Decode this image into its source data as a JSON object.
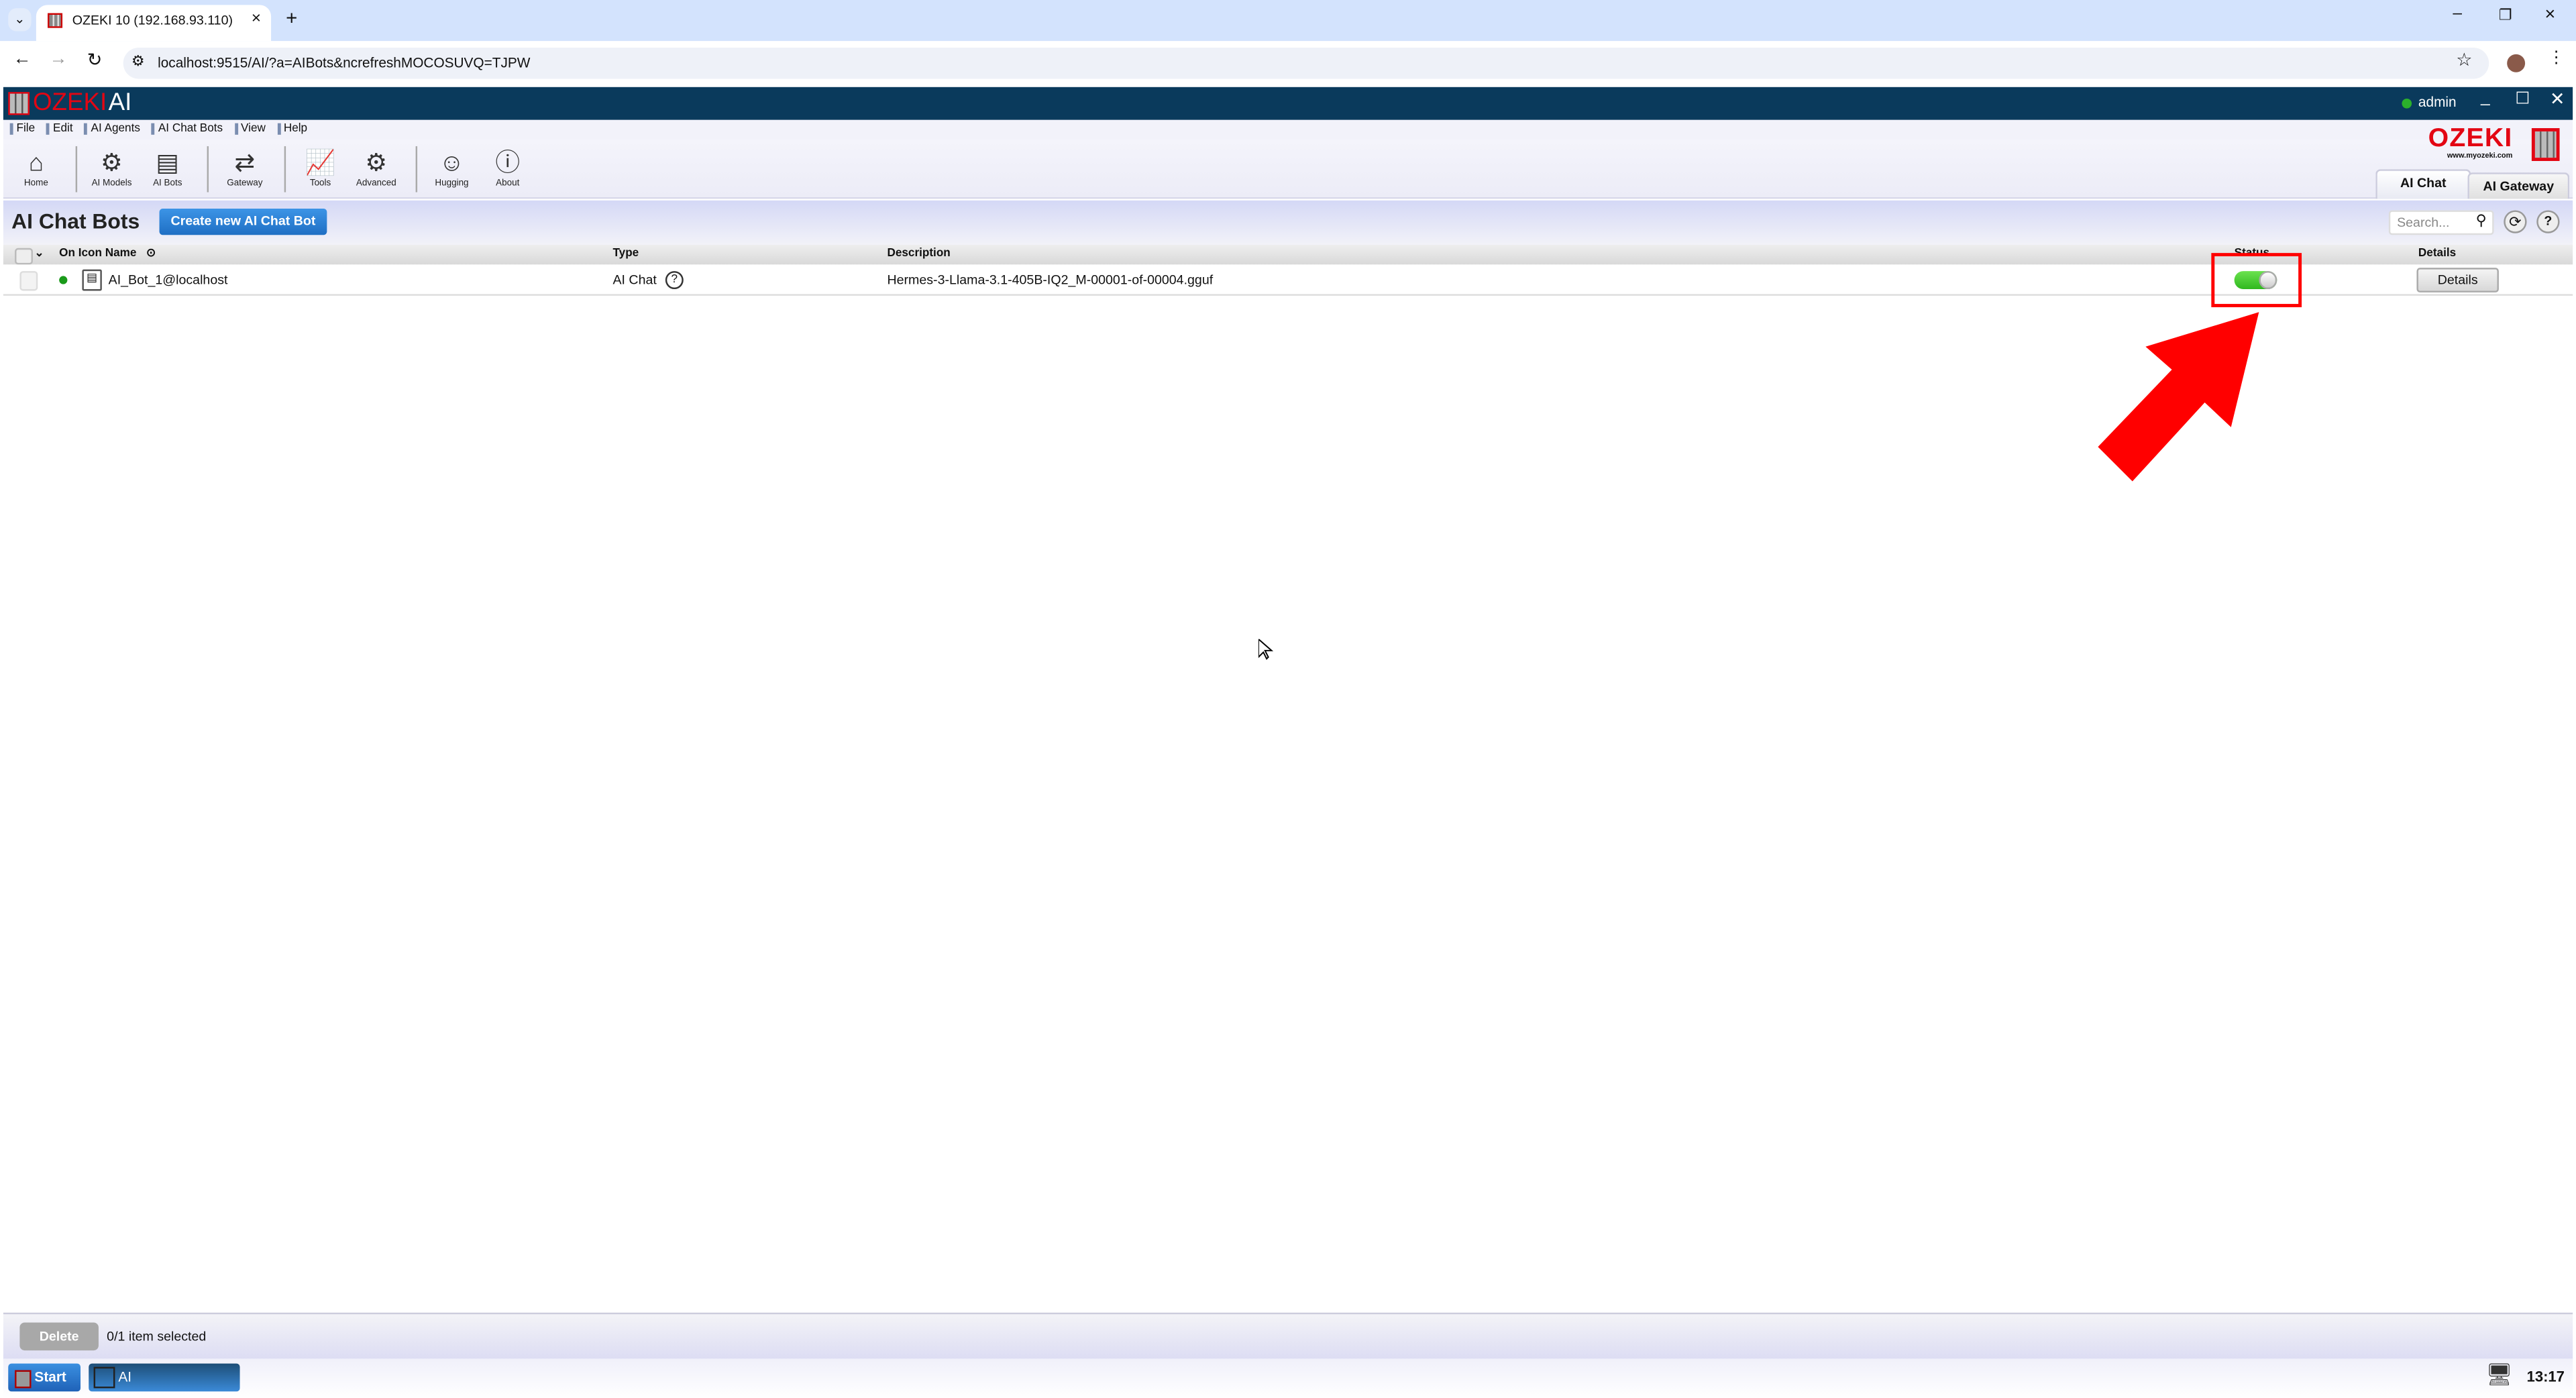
{
  "browser": {
    "tab_title": "OZEKI 10 (192.168.93.110)",
    "url": "localhost:9515/AI/?a=AIBots&ncrefreshMOCOSUVQ=TJPW"
  },
  "app": {
    "logo_text": "OZEKI",
    "logo_suffix": "AI",
    "user": "admin",
    "brand": "OZEKI",
    "brand_url": "www.myozeki.com"
  },
  "menu": [
    "File",
    "Edit",
    "AI Agents",
    "AI Chat Bots",
    "View",
    "Help"
  ],
  "toolbar": [
    {
      "label": "Home",
      "icon": "home-icon"
    },
    {
      "label": "AI Models",
      "icon": "ai-models-icon"
    },
    {
      "label": "AI Bots",
      "icon": "ai-bots-icon"
    },
    {
      "label": "Gateway",
      "icon": "gateway-icon"
    },
    {
      "label": "Tools",
      "icon": "tools-icon"
    },
    {
      "label": "Advanced",
      "icon": "gear-icon"
    },
    {
      "label": "Hugging",
      "icon": "hugging-face-icon"
    },
    {
      "label": "About",
      "icon": "info-icon"
    }
  ],
  "view_tabs": [
    "AI Chat",
    "AI Gateway"
  ],
  "page": {
    "title": "AI Chat Bots",
    "create_button": "Create new AI Chat Bot",
    "search_placeholder": "Search..."
  },
  "table": {
    "headers": {
      "name": "On Icon Name",
      "type": "Type",
      "description": "Description",
      "status": "Status",
      "details": "Details"
    },
    "rows": [
      {
        "name": "AI_Bot_1@localhost",
        "type": "AI Chat",
        "description": "Hermes-3-Llama-3.1-405B-IQ2_M-00001-of-00004.gguf",
        "status_on": true,
        "details": "Details"
      }
    ]
  },
  "footer": {
    "delete": "Delete",
    "selection": "0/1 item selected"
  },
  "taskbar": {
    "start": "Start",
    "app": "AI",
    "clock": "13:17"
  },
  "colors": {
    "header": "#0a3a5c",
    "accent": "#2a7fd4",
    "brand_red": "#e30613",
    "toggle_on": "#3ecb2a",
    "highlight": "#ff0000"
  }
}
